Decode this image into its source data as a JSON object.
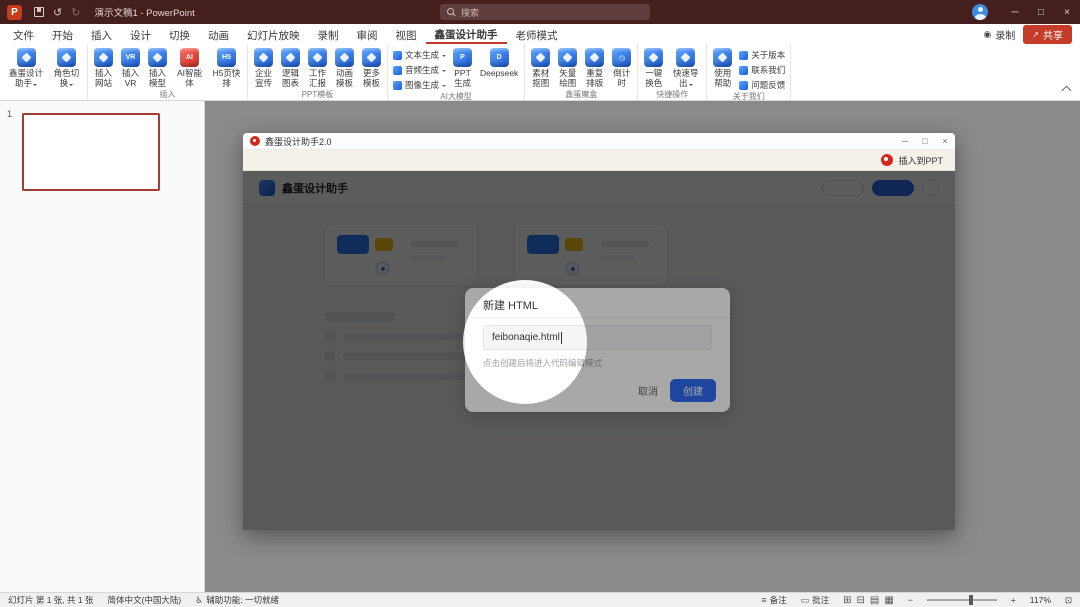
{
  "icons": {
    "pp_logo": "P",
    "undo": "↺",
    "redo": "↻",
    "minimize": "─",
    "maximize": "□",
    "close": "×",
    "record_dot": "◉",
    "share_arrow": "↗",
    "vr": "VR",
    "h5": "H5",
    "ai": "AI",
    "ppt": "P",
    "deepseek": "D",
    "clock": "◷",
    "plugin_min": "─",
    "plugin_max": "□",
    "plugin_close": "×",
    "notes": "≡",
    "comments": "▭",
    "view_normal": "⊞",
    "view_sorter": "⊟",
    "view_reading": "▤",
    "view_slideshow": "▦",
    "zoom_out": "−",
    "zoom_in": "+",
    "fit": "⊡",
    "accessibility": "♿"
  },
  "titlebar": {
    "app_title": "演示文稿1 - PowerPoint",
    "search_placeholder": "搜索"
  },
  "ribbon": {
    "tabs": [
      "文件",
      "开始",
      "插入",
      "设计",
      "切换",
      "动画",
      "幻灯片放映",
      "录制",
      "审阅",
      "视图",
      "鑫蛋设计助手",
      "老师模式"
    ],
    "record_label": "录制",
    "share_label": "共享",
    "group_labels": [
      "插入",
      "PPT模板",
      "AI大模型",
      "鑫蛋魔盒",
      "快捷操作",
      "关于我们"
    ],
    "big_buttons": [
      "鑫蛋设计助手",
      "角色切换",
      "插入网站",
      "插入VR",
      "插入模型",
      "AI智能体",
      "H5页快排",
      "企业宣传",
      "逻辑图表",
      "工作汇报",
      "动画模板",
      "更多模板",
      "PPT生成",
      "Deepseek",
      "素材抠图",
      "矢量绘图",
      "重复排版",
      "倒计时",
      "一键换色",
      "快速导出",
      "使用帮助"
    ],
    "ai_stack": [
      "文本生成",
      "音频生成",
      "图像生成"
    ],
    "about_stack": [
      "关于版本",
      "联系我们",
      "问题反馈"
    ]
  },
  "slides_panel": {
    "slide_number": "1"
  },
  "plugin_window": {
    "title": "鑫蛋设计助手2.0",
    "insert_to_ppt_label": "插入到PPT",
    "webpage": {
      "logo_text": "鑫蛋设计助手"
    },
    "modal": {
      "title": "新建 HTML",
      "input_value": "feibonaqie.html",
      "helper_text": "点击创建后将进入代码编辑模式",
      "cancel_label": "取消",
      "create_label": "创建"
    }
  },
  "status_bar": {
    "slide_info": "幻灯片 第 1 张, 共 1 张",
    "language": "简体中文(中国大陆)",
    "accessibility": "辅助功能: 一切就绪",
    "notes_label": "备注",
    "comments_label": "批注",
    "zoom_percent": "117%"
  },
  "colors": {
    "titlebar_bg": "#451e1e",
    "active_tab_underline": "#c0392b",
    "share_button": "#c53d2a",
    "primary_blue": "#2e6bf0",
    "card_blue": "#2e7df6",
    "card_yellow": "#f6c51c",
    "plugin_logo_red": "#d8271c"
  }
}
